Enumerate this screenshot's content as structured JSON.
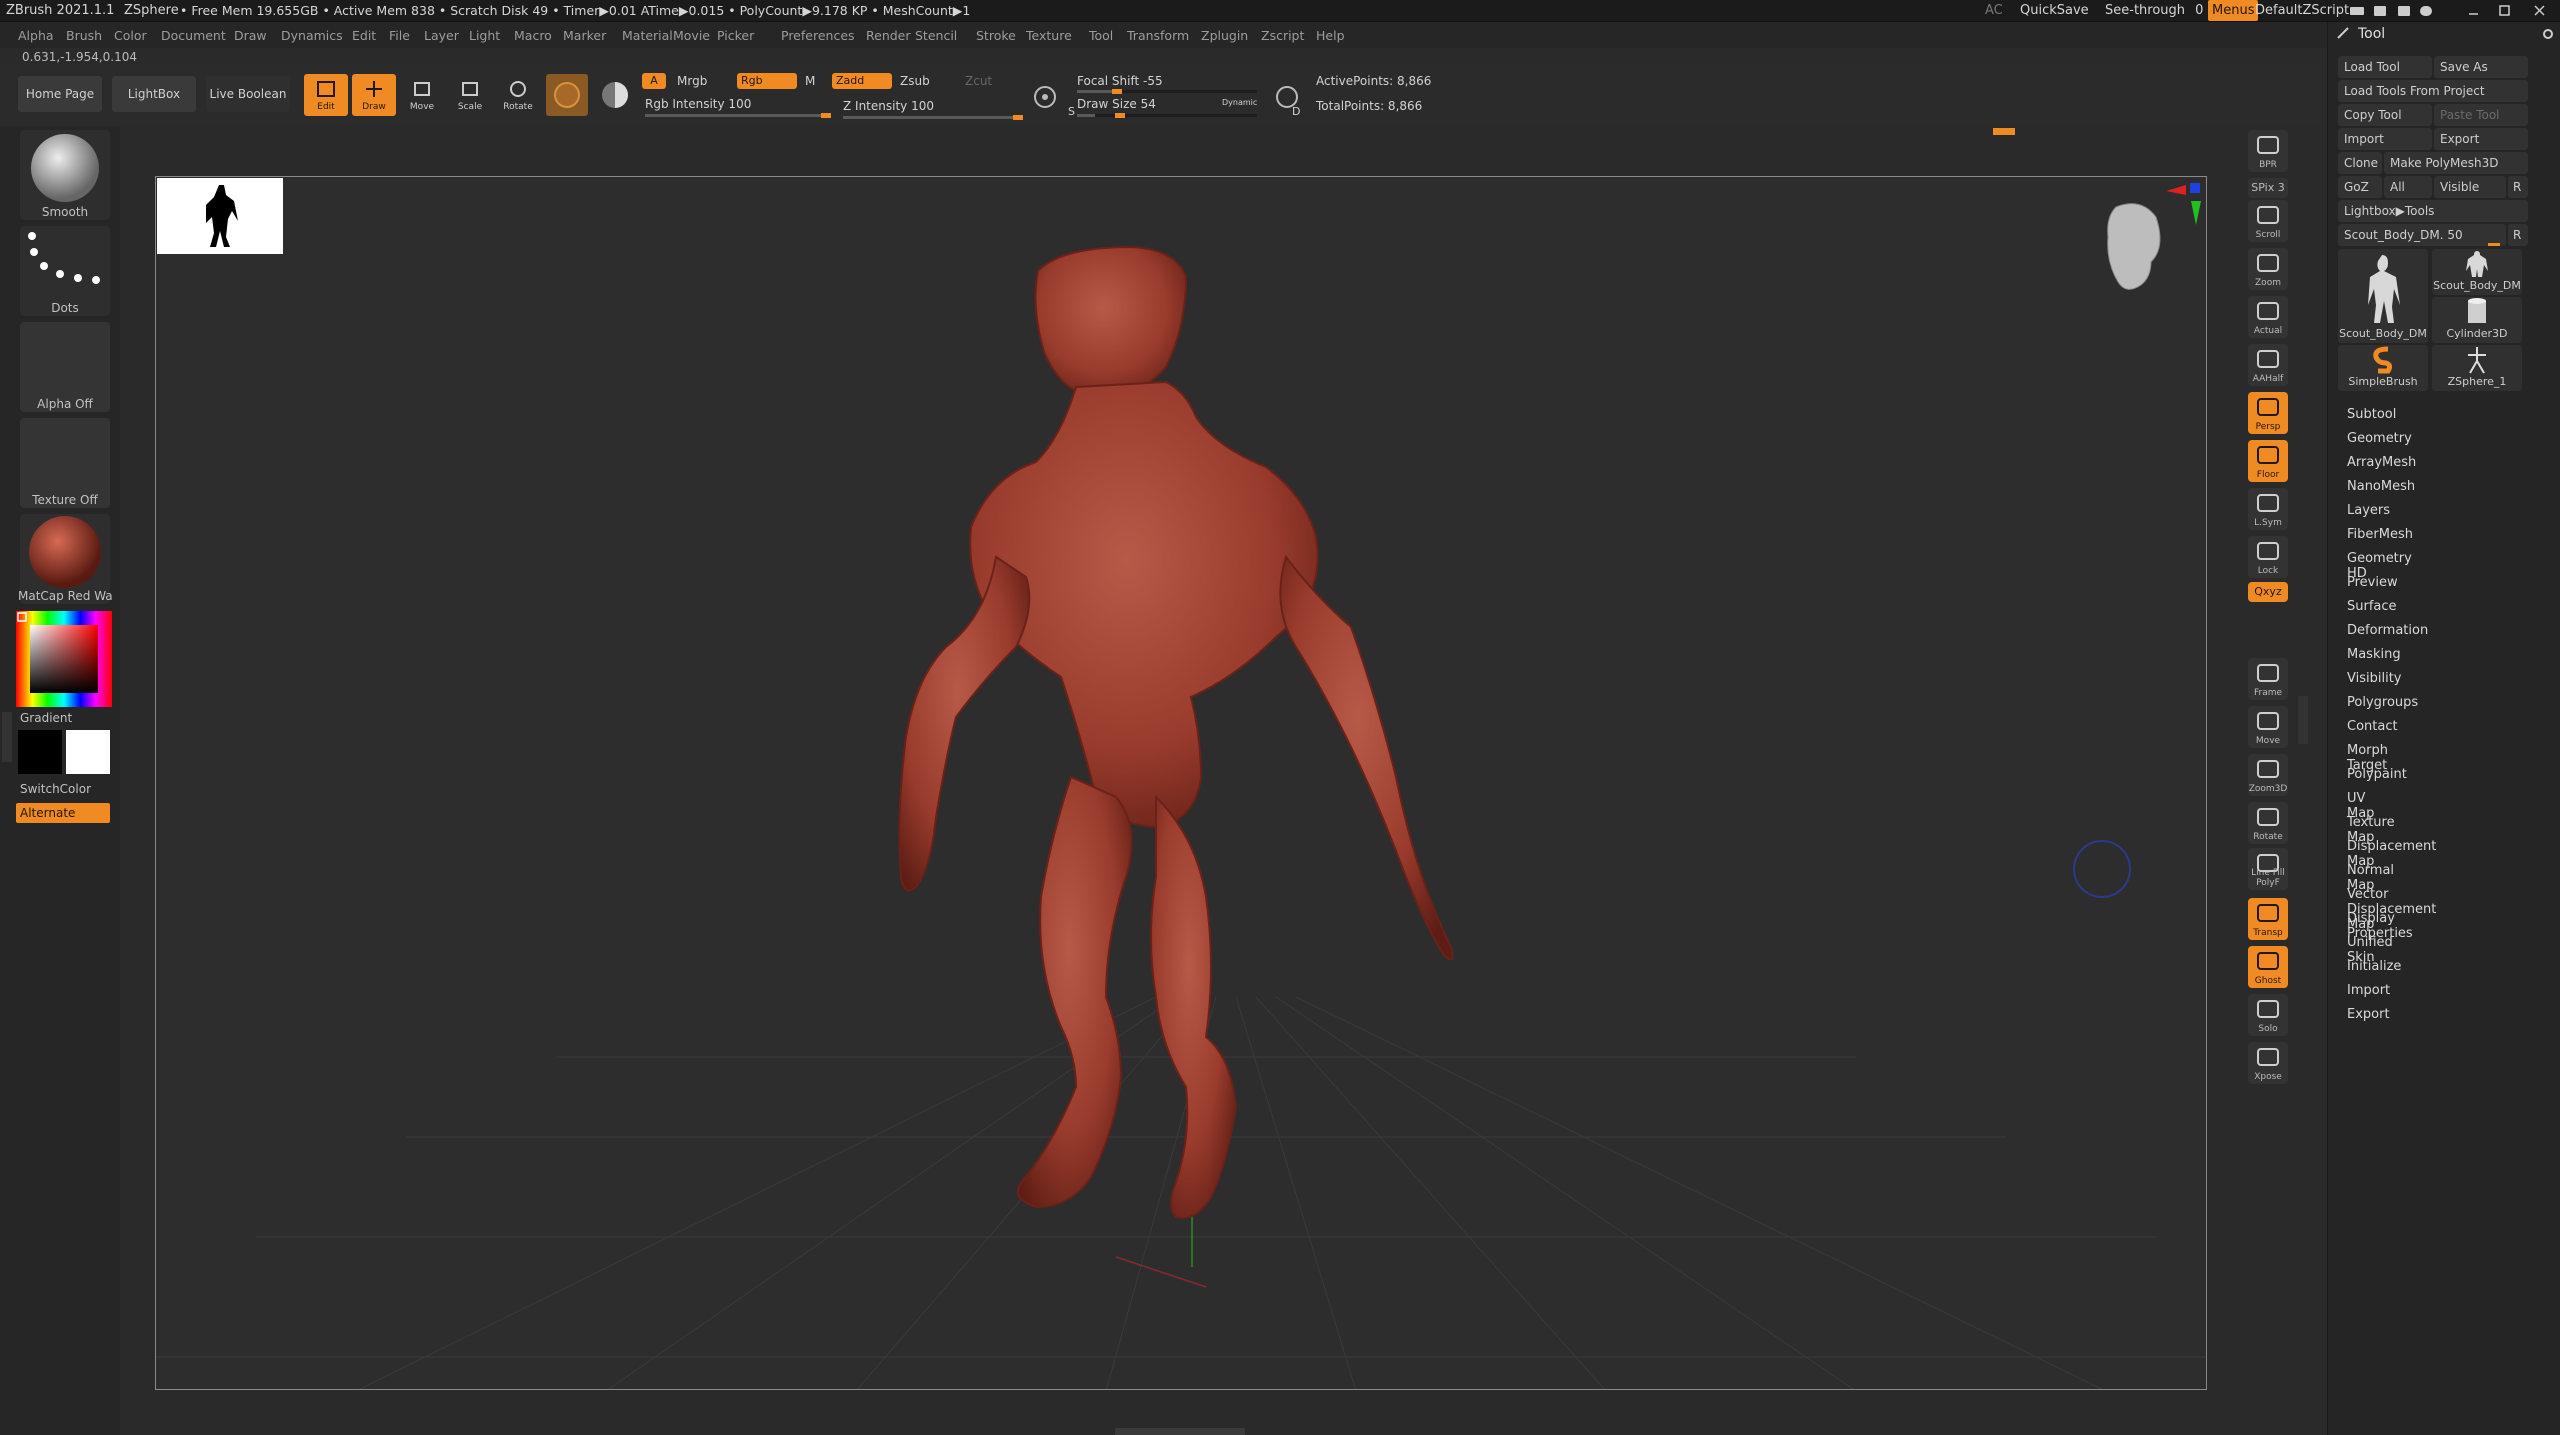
{
  "titlebar": {
    "app": "ZBrush 2021.1.1",
    "tool_name": "ZSphere",
    "stats": "• Free Mem 19.655GB • Active Mem 838 • Scratch Disk 49 • Timer▶0.01 ATime▶0.015 • PolyCount▶9.178 KP • MeshCount▶1",
    "ac": "AC",
    "quicksave": "QuickSave",
    "see_through": "See-through",
    "see_through_value": "0",
    "menus": "Menus",
    "script": "DefaultZScript"
  },
  "menubar": [
    "Alpha",
    "Brush",
    "Color",
    "Document",
    "Draw",
    "Dynamics",
    "Edit",
    "File",
    "Layer",
    "Light",
    "Macro",
    "Marker",
    "Material",
    "Movie",
    "Picker",
    "Preferences",
    "Render",
    "Stencil",
    "Stroke",
    "Texture",
    "Tool",
    "Transform",
    "Zplugin",
    "Zscript",
    "Help"
  ],
  "coords": "0.631,-1.954,0.104",
  "toolbar": {
    "home_page": "Home Page",
    "lightbox": "LightBox",
    "live_boolean": "Live Boolean",
    "edit": "Edit",
    "draw": "Draw",
    "move": "Move",
    "scale": "Scale",
    "rotate": "Rotate",
    "a": "A",
    "mrgb": "Mrgb",
    "rgb": "Rgb",
    "m": "M",
    "zadd": "Zadd",
    "zsub": "Zsub",
    "zcut": "Zcut",
    "rgb_intensity": "Rgb Intensity 100",
    "rgb_intensity_value": 100,
    "z_intensity": "Z Intensity 100",
    "z_intensity_value": 100,
    "focal_shift": "Focal Shift -55",
    "focal_shift_value": -55,
    "draw_size": "Draw Size 54",
    "draw_size_value": 54,
    "dynamic": "Dynamic",
    "active_points": "ActivePoints: 8,866",
    "total_points": "TotalPoints: 8,866",
    "s": "S",
    "d": "D"
  },
  "leftshelf": {
    "brush": "Smooth",
    "stroke": "Dots",
    "alpha": "Alpha Off",
    "texture": "Texture Off",
    "material": "MatCap Red Wax",
    "gradient": "Gradient",
    "switch_color": "SwitchColor",
    "alternate": "Alternate"
  },
  "rightshelf": [
    {
      "label": "BPR",
      "active": false
    },
    {
      "label": "SPix 3",
      "active": false
    },
    {
      "label": "Scroll",
      "active": false
    },
    {
      "label": "Zoom",
      "active": false
    },
    {
      "label": "Actual",
      "active": false
    },
    {
      "label": "AAHalf",
      "active": false
    },
    {
      "label": "Persp",
      "active": true
    },
    {
      "label": "Floor",
      "active": true
    },
    {
      "label": "L.Sym",
      "active": false
    },
    {
      "label": "Lock",
      "active": false
    },
    {
      "label": "Qxyz",
      "active": true
    },
    {
      "label": "Frame",
      "active": false
    },
    {
      "label": "Move",
      "active": false
    },
    {
      "label": "Zoom3D",
      "active": false
    },
    {
      "label": "Rotate",
      "active": false
    },
    {
      "label": "Line Fill PolyF",
      "active": false
    },
    {
      "label": "Transp",
      "active": true
    },
    {
      "label": "Ghost",
      "active": true
    },
    {
      "label": "Solo",
      "active": false
    },
    {
      "label": "Xpose",
      "active": false
    }
  ],
  "toolpanel": {
    "title": "Tool",
    "load_tool": "Load Tool",
    "save_as": "Save As",
    "load_from_project": "Load Tools From Project",
    "copy_tool": "Copy Tool",
    "paste_tool": "Paste Tool",
    "import": "Import",
    "export": "Export",
    "clone": "Clone",
    "make_polymesh": "Make PolyMesh3D",
    "goz": "GoZ",
    "all": "All",
    "visible": "Visible",
    "r": "R",
    "lightbox_tools": "Lightbox▶Tools",
    "current_tool": "Scout_Body_DM. 50",
    "tools": [
      {
        "name": "Scout_Body_DM"
      },
      {
        "name": "Scout_Body_DM"
      },
      {
        "name": "Cylinder3D"
      },
      {
        "name": "SimpleBrush"
      },
      {
        "name": "ZSphere_1"
      }
    ],
    "subpalettes": [
      "Subtool",
      "Geometry",
      "ArrayMesh",
      "NanoMesh",
      "Layers",
      "FiberMesh",
      "Geometry HD",
      "Preview",
      "Surface",
      "Deformation",
      "Masking",
      "Visibility",
      "Polygroups",
      "Contact",
      "Morph Target",
      "Polypaint",
      "UV Map",
      "Texture Map",
      "Displacement Map",
      "Normal Map",
      "Vector Displacement Map",
      "Display Properties",
      "Unified Skin",
      "Initialize",
      "Import",
      "Export"
    ]
  },
  "colors": {
    "accent": "#f08a23",
    "model": "#a34030",
    "viewport_bg": "#2d2d2d"
  }
}
